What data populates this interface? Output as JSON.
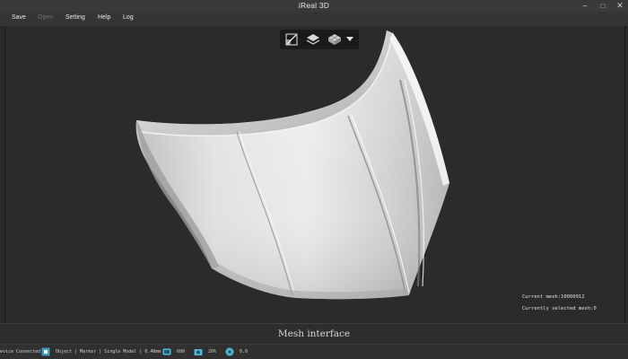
{
  "window": {
    "title": "iReal 3D",
    "minimize_glyph": "–",
    "maximize_glyph": "□",
    "close_glyph": "✕"
  },
  "menu": {
    "items": [
      {
        "label": "Save",
        "enabled": true
      },
      {
        "label": "Open",
        "enabled": false
      },
      {
        "label": "Setting",
        "enabled": true
      },
      {
        "label": "Help",
        "enabled": true
      },
      {
        "label": "Log",
        "enabled": true
      }
    ]
  },
  "toolbar": {
    "buttons": [
      {
        "icon": "edit-mesh-icon"
      },
      {
        "icon": "layer-stack-icon"
      },
      {
        "icon": "mesh-grid-icon"
      },
      {
        "icon": "dropdown-arrow-icon"
      }
    ]
  },
  "viewport": {
    "stats": {
      "current_mesh": "Current mesh:10060912",
      "selected_mesh": "Currently selected mesh:0"
    }
  },
  "caption": "Mesh interface",
  "status": {
    "connection": "evice Connected",
    "scan_mode": "Object | Marker | Single Model | 0.40mm",
    "value_1": "600",
    "value_2": "20%",
    "value_3": "0.0"
  },
  "colors": {
    "background": "#2b2b2b",
    "mesh_light": "#f2f2f2",
    "mesh_mid": "#c4c4c4",
    "mesh_dark": "#8a8a8a",
    "status_accent": "#4fb8d8"
  }
}
